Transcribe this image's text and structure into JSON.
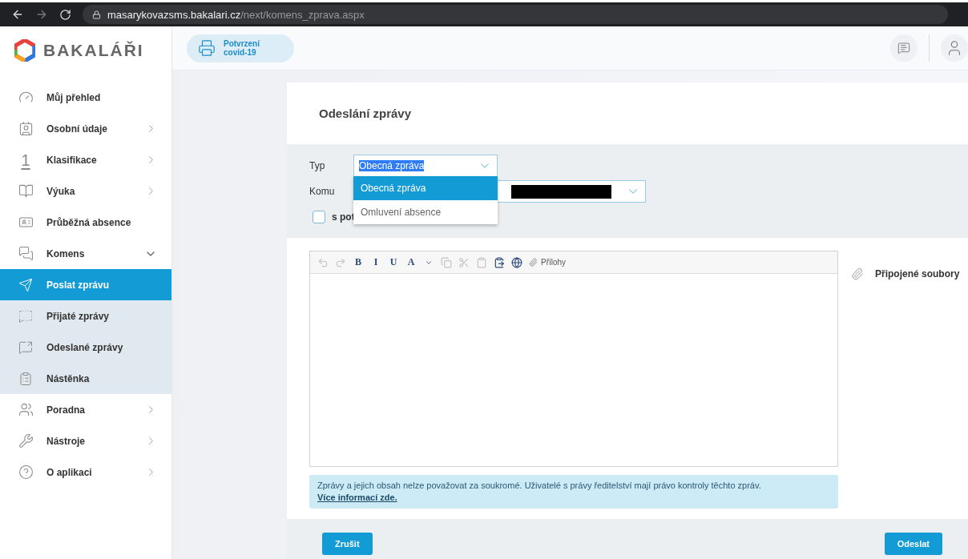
{
  "browser": {
    "url_host": "masarykovazsms.bakalari.cz",
    "url_path": "/next/komens_zprava.aspx"
  },
  "logo": {
    "text": "BAKALÁŘI"
  },
  "header": {
    "covid_button": "Potvrzení covid-19"
  },
  "sidebar": {
    "items": [
      {
        "label": "Můj přehled",
        "kind": "link",
        "selected": false
      },
      {
        "label": "Osobní údaje",
        "kind": "menu",
        "expanded": false,
        "selected": false
      },
      {
        "label": "Klasifikace",
        "kind": "menu",
        "expanded": false,
        "selected": false,
        "glyph": "1"
      },
      {
        "label": "Výuka",
        "kind": "menu",
        "expanded": false,
        "selected": false
      },
      {
        "label": "Průběžná absence",
        "kind": "link",
        "selected": false
      },
      {
        "label": "Komens",
        "kind": "menu",
        "expanded": true,
        "selected": false,
        "children": [
          {
            "label": "Poslat zprávu",
            "selected": true
          },
          {
            "label": "Přijaté zprávy",
            "selected": false
          },
          {
            "label": "Odeslané zprávy",
            "selected": false
          },
          {
            "label": "Nástěnka",
            "selected": false
          }
        ]
      },
      {
        "label": "Poradna",
        "kind": "menu",
        "expanded": false,
        "selected": false
      },
      {
        "label": "Nástroje",
        "kind": "menu",
        "expanded": false,
        "selected": false
      },
      {
        "label": "O aplikaci",
        "kind": "menu",
        "expanded": false,
        "selected": false
      }
    ]
  },
  "form": {
    "title": "Odeslání zprávy",
    "type_label": "Typ",
    "type_value": "Obecná zpráva",
    "type_options": [
      {
        "label": "Obecná zpráva",
        "selected": true
      },
      {
        "label": "Omluvení absence",
        "selected": false
      }
    ],
    "to_label": "Komu",
    "checkbox": {
      "label": "s pot",
      "checked": false
    }
  },
  "editor": {
    "toolbar": [
      {
        "kind": "icon",
        "disabled": true
      },
      {
        "kind": "icon",
        "disabled": true
      },
      {
        "kind": "text",
        "label": "B",
        "disabled": false
      },
      {
        "kind": "text",
        "label": "I",
        "disabled": false
      },
      {
        "kind": "text",
        "label": "U",
        "disabled": false
      },
      {
        "kind": "text",
        "label": "A",
        "disabled": false
      },
      {
        "kind": "icon",
        "disabled": false
      },
      {
        "kind": "icon",
        "disabled": true
      },
      {
        "kind": "icon",
        "disabled": true
      },
      {
        "kind": "icon",
        "disabled": true
      },
      {
        "kind": "icon",
        "disabled": false
      },
      {
        "kind": "icon",
        "disabled": false
      },
      {
        "kind": "attach",
        "label": "Přílohy"
      }
    ],
    "attachments_label": "Připojené soubory"
  },
  "notice": {
    "text": "Zprávy a jejich obsah nelze považovat za soukromé. Uživatelé s právy ředitelství mají právo kontroly těchto zpráv.",
    "link": "Více informací zde."
  },
  "buttons": {
    "cancel": "Zrušit",
    "send": "Odeslat"
  }
}
